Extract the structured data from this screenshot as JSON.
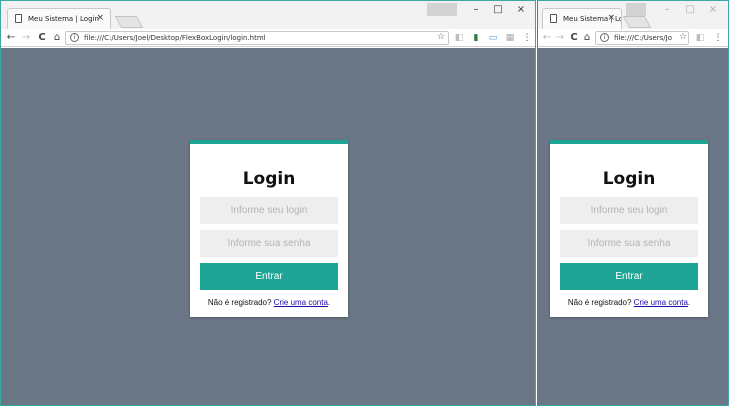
{
  "browser_left": {
    "tab_title": "Meu Sistema | Login",
    "url": "file:///C:/Users/Joel/Desktop/FlexBoxLogin/login.html"
  },
  "browser_right": {
    "tab_title": "Meu Sistema | Lo",
    "url": "file:///C:/Users/Jo"
  },
  "icons": {
    "tab_close": "×",
    "minimize": "–",
    "maximize": "□",
    "close": "×",
    "back": "←",
    "forward": "→",
    "reload": "C",
    "home": "⌂",
    "info": "i",
    "star": "☆",
    "menu": "⋮"
  },
  "login": {
    "title": "Login",
    "login_placeholder": "Informe seu login",
    "password_placeholder": "Informe sua senha",
    "submit_label": "Entrar",
    "signup_prompt": "Não é registrado?",
    "signup_link": "Crie uma conta",
    "signup_suffix": "."
  },
  "colors": {
    "page_background": "#6b7786",
    "accent": "#1fa595",
    "card": "#ffffff",
    "input_background": "#eeeeee"
  }
}
